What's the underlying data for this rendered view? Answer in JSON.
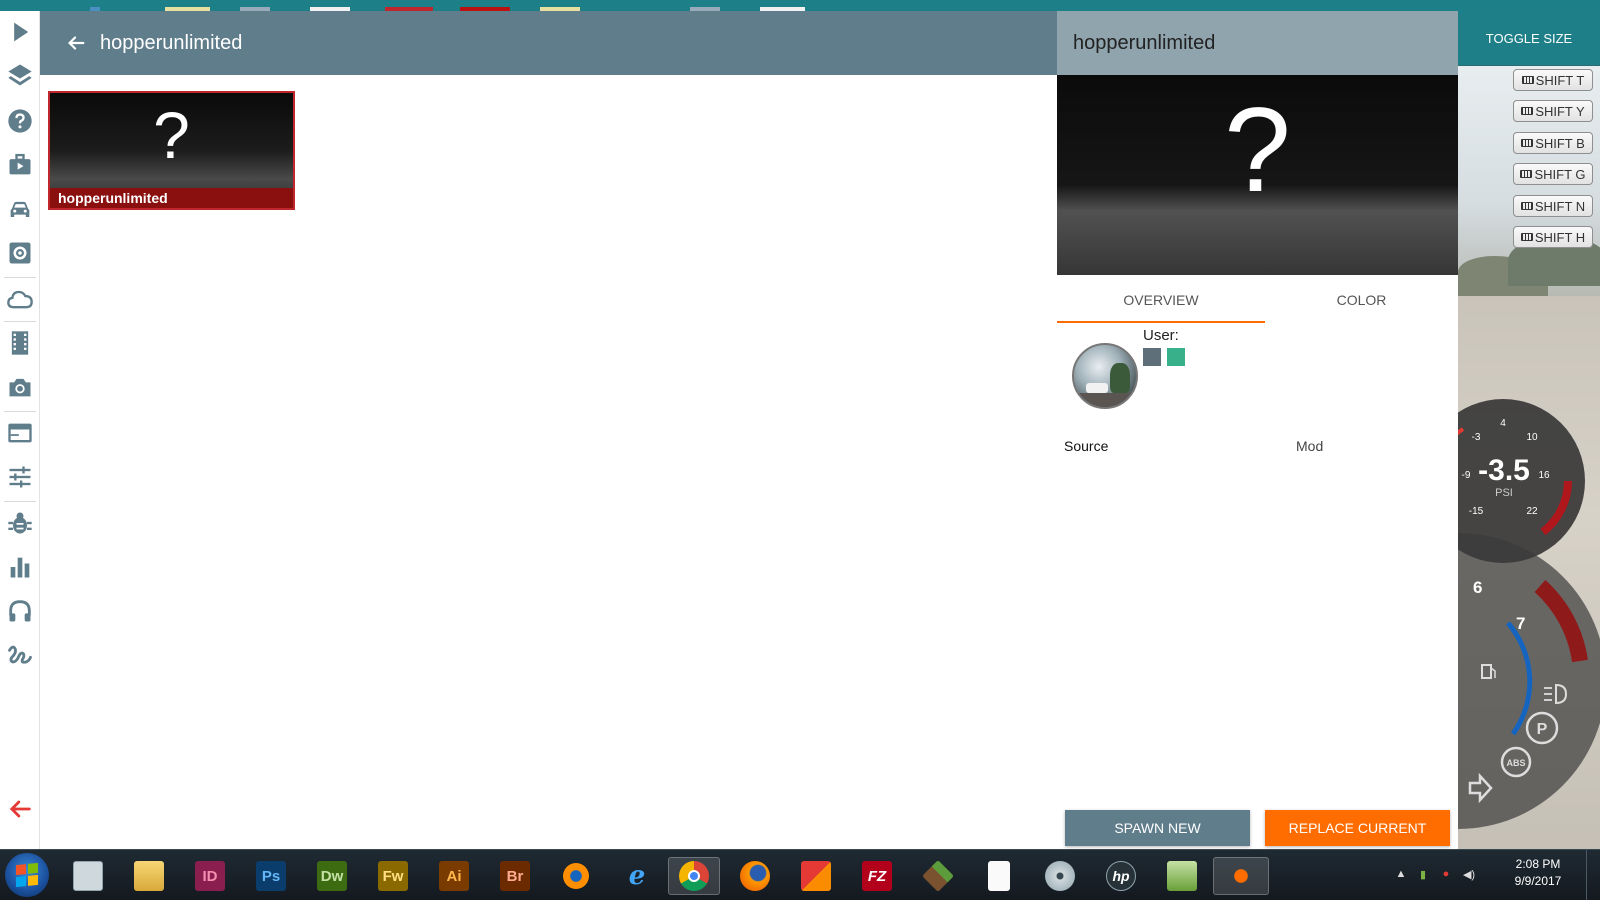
{
  "colors": {
    "header_bg": "#607d8b",
    "detail_header_bg": "#90a4ae",
    "accent_orange": "#ff6d00",
    "tile_border": "#c0262c",
    "tile_label_bg": "#8a0f0f",
    "teal_frame": "#1d7f88"
  },
  "sidebar": {
    "items": [
      {
        "name": "play-icon"
      },
      {
        "name": "layers-icon"
      },
      {
        "name": "help-icon"
      },
      {
        "name": "briefcase-icon"
      },
      {
        "name": "car-icon"
      },
      {
        "name": "gear-icon"
      },
      {
        "name": "cloud-icon"
      },
      {
        "name": "film-icon"
      },
      {
        "name": "camera-icon"
      },
      {
        "name": "browser-window-icon"
      },
      {
        "name": "sliders-icon"
      },
      {
        "name": "bug-icon"
      },
      {
        "name": "bar-chart-icon"
      },
      {
        "name": "headphones-icon"
      },
      {
        "name": "squiggle-icon"
      }
    ],
    "back_icon": "arrow-left-icon"
  },
  "main": {
    "title": "hopperunlimited",
    "tiles": [
      {
        "glyph": "?",
        "label": "hopperunlimited",
        "selected": true
      }
    ]
  },
  "detail": {
    "title": "hopperunlimited",
    "preview_glyph": "?",
    "tabs": [
      {
        "label": "OVERVIEW",
        "active": true
      },
      {
        "label": "COLOR",
        "active": false
      }
    ],
    "user_label": "User:",
    "swatches": [
      "#5f6f7a",
      "#38b08a"
    ],
    "source_label": "Source",
    "source_value": "Mod",
    "spawn_button": "SPAWN NEW",
    "replace_button": "REPLACE CURRENT"
  },
  "game": {
    "toggle_size": "TOGGLE SIZE",
    "shortcuts": [
      "SHIFT T",
      "SHIFT Y",
      "SHIFT B",
      "SHIFT G",
      "SHIFT N",
      "SHIFT H"
    ],
    "boost_gauge": {
      "value": "-3.5",
      "unit": "PSI",
      "ticks": [
        "4",
        "10",
        "16",
        "22",
        "-3",
        "-9",
        "-15"
      ]
    },
    "tacho": {
      "ticks": [
        "6",
        "7"
      ],
      "indicators": [
        "fuel-icon",
        "headlight-icon",
        "parking-brake-icon",
        "abs-icon",
        "turn-signal-icon"
      ],
      "indicator_text": {
        "parking": "P",
        "abs": "ABS"
      }
    }
  },
  "taskbar": {
    "apps": [
      {
        "name": "calculator",
        "icon": "calculator-icon"
      },
      {
        "name": "explorer",
        "icon": "folder-icon"
      },
      {
        "name": "indesign",
        "icon": "indesign-icon",
        "text": "ID",
        "color": "#8a1f4f"
      },
      {
        "name": "photoshop",
        "icon": "photoshop-icon",
        "text": "Ps",
        "color": "#0a3d6b"
      },
      {
        "name": "dreamweaver",
        "icon": "dreamweaver-icon",
        "text": "Dw",
        "color": "#3d6b12"
      },
      {
        "name": "fireworks",
        "icon": "fireworks-icon",
        "text": "Fw",
        "color": "#8a6a00"
      },
      {
        "name": "illustrator",
        "icon": "illustrator-icon",
        "text": "Ai",
        "color": "#7a3b00"
      },
      {
        "name": "bridge",
        "icon": "bridge-icon",
        "text": "Br",
        "color": "#6b2a00"
      },
      {
        "name": "blender",
        "icon": "blender-icon"
      },
      {
        "name": "internet-explorer",
        "icon": "ie-icon"
      },
      {
        "name": "chrome",
        "icon": "chrome-icon"
      },
      {
        "name": "firefox",
        "icon": "firefox-icon"
      },
      {
        "name": "office",
        "icon": "office-icon"
      },
      {
        "name": "filezilla",
        "icon": "filezilla-icon",
        "text": "FZ",
        "color": "#b3001b"
      },
      {
        "name": "minecraft",
        "icon": "minecraft-icon"
      },
      {
        "name": "notepad",
        "icon": "document-icon"
      },
      {
        "name": "media-player",
        "icon": "disc-icon"
      },
      {
        "name": "hp",
        "icon": "hp-icon"
      },
      {
        "name": "text-editor",
        "icon": "editor-icon"
      },
      {
        "name": "beamng",
        "icon": "beamng-icon"
      }
    ],
    "clock_time": "2:08 PM",
    "clock_date": "9/9/2017",
    "tray_icons": [
      "chevron-up-icon",
      "network-icon",
      "security-icon",
      "volume-icon"
    ]
  }
}
